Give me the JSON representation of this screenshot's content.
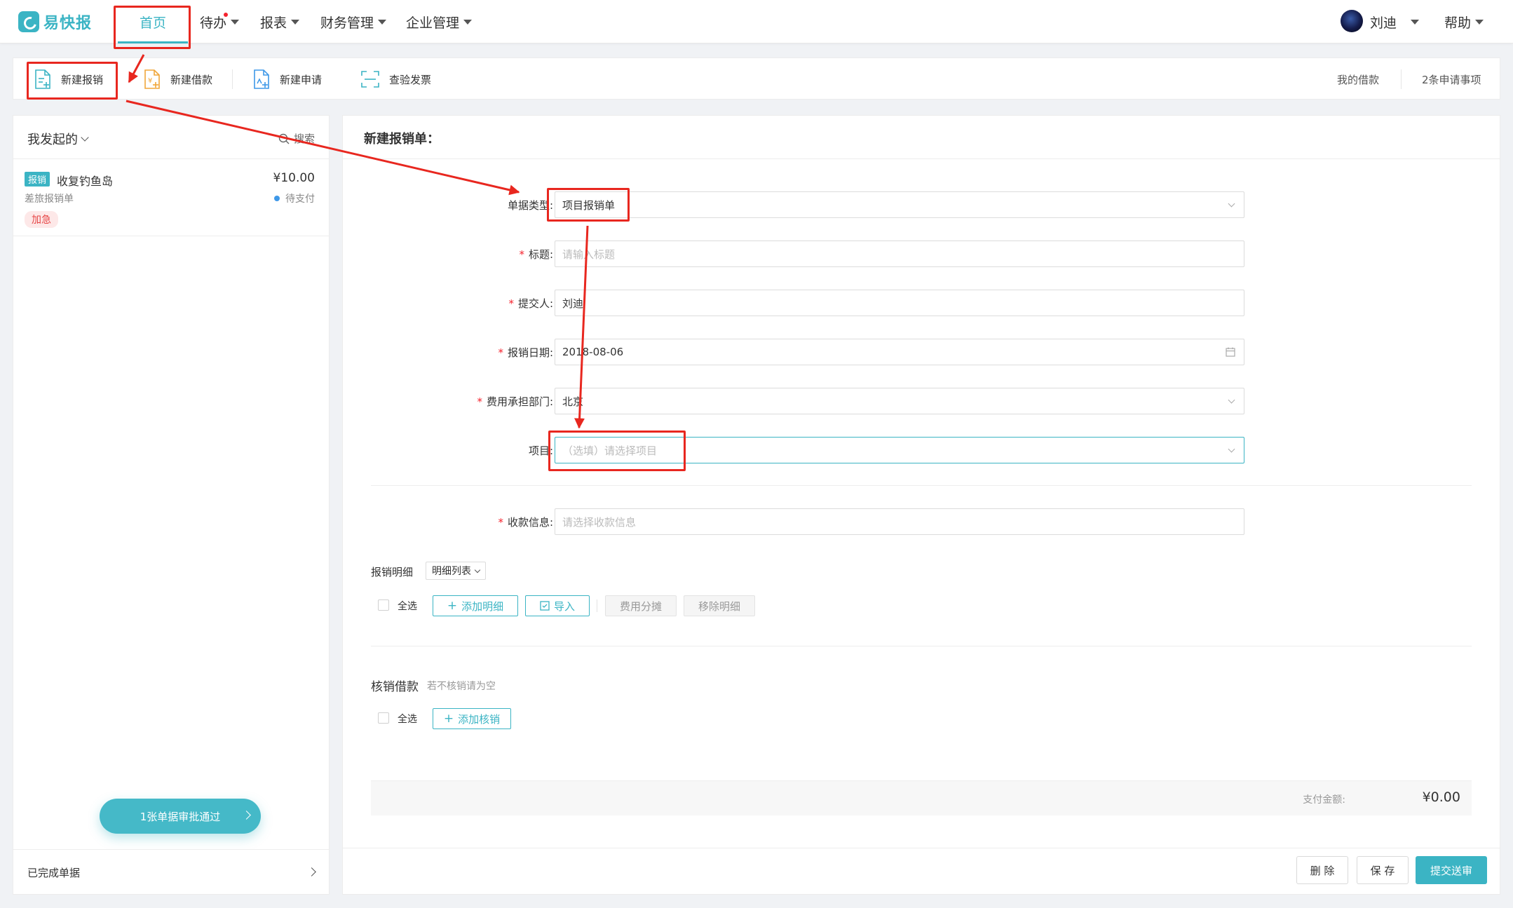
{
  "app": {
    "logo_text": "易快报",
    "brand_color": "#3bb4c4",
    "annotation_color": "#e8271f"
  },
  "nav": {
    "home": "首页",
    "todo": "待办",
    "reports": "报表",
    "finance": "财务管理",
    "enterprise": "企业管理",
    "user_name": "刘迪",
    "help": "帮助"
  },
  "toolbar": {
    "new_expense": "新建报销",
    "new_loan": "新建借款",
    "new_request": "新建申请",
    "check_invoice": "查验发票",
    "my_loans": "我的借款",
    "pending_requests": "2条申请事项"
  },
  "left": {
    "filter_label": "我发起的",
    "search_label": "搜索",
    "card": {
      "tag": "报销",
      "title": "收复钓鱼岛",
      "amount": "¥10.00",
      "type": "差旅报销单",
      "status": "待支付",
      "priority": "加急"
    },
    "approved_notice": "1张单据审批通过",
    "completed": "已完成单据"
  },
  "form": {
    "title": "新建报销单：",
    "doc_type_label": "单据类型:",
    "doc_type_value": "项目报销单",
    "title_label": "标题:",
    "title_placeholder": "请输入标题",
    "submitter_label": "提交人:",
    "submitter_value": "刘迪",
    "date_label": "报销日期:",
    "date_value": "2018-08-06",
    "dept_label": "费用承担部门:",
    "dept_value": "北京",
    "project_label": "项目:",
    "project_placeholder": "（选填）请选择项目",
    "payee_label": "收款信息:",
    "payee_placeholder": "请选择收款信息",
    "details_label": "报销明细",
    "details_view": "明细列表",
    "select_all": "全选",
    "add_detail": "添加明细",
    "import": "导入",
    "split_cost": "费用分摊",
    "remove_detail": "移除明细",
    "offset_label": "核销借款",
    "offset_hint": "若不核销请为空",
    "add_offset": "添加核销",
    "pay_label": "支付金额:",
    "pay_amount": "¥0.00",
    "delete": "删 除",
    "save": "保 存",
    "submit": "提交送审"
  }
}
